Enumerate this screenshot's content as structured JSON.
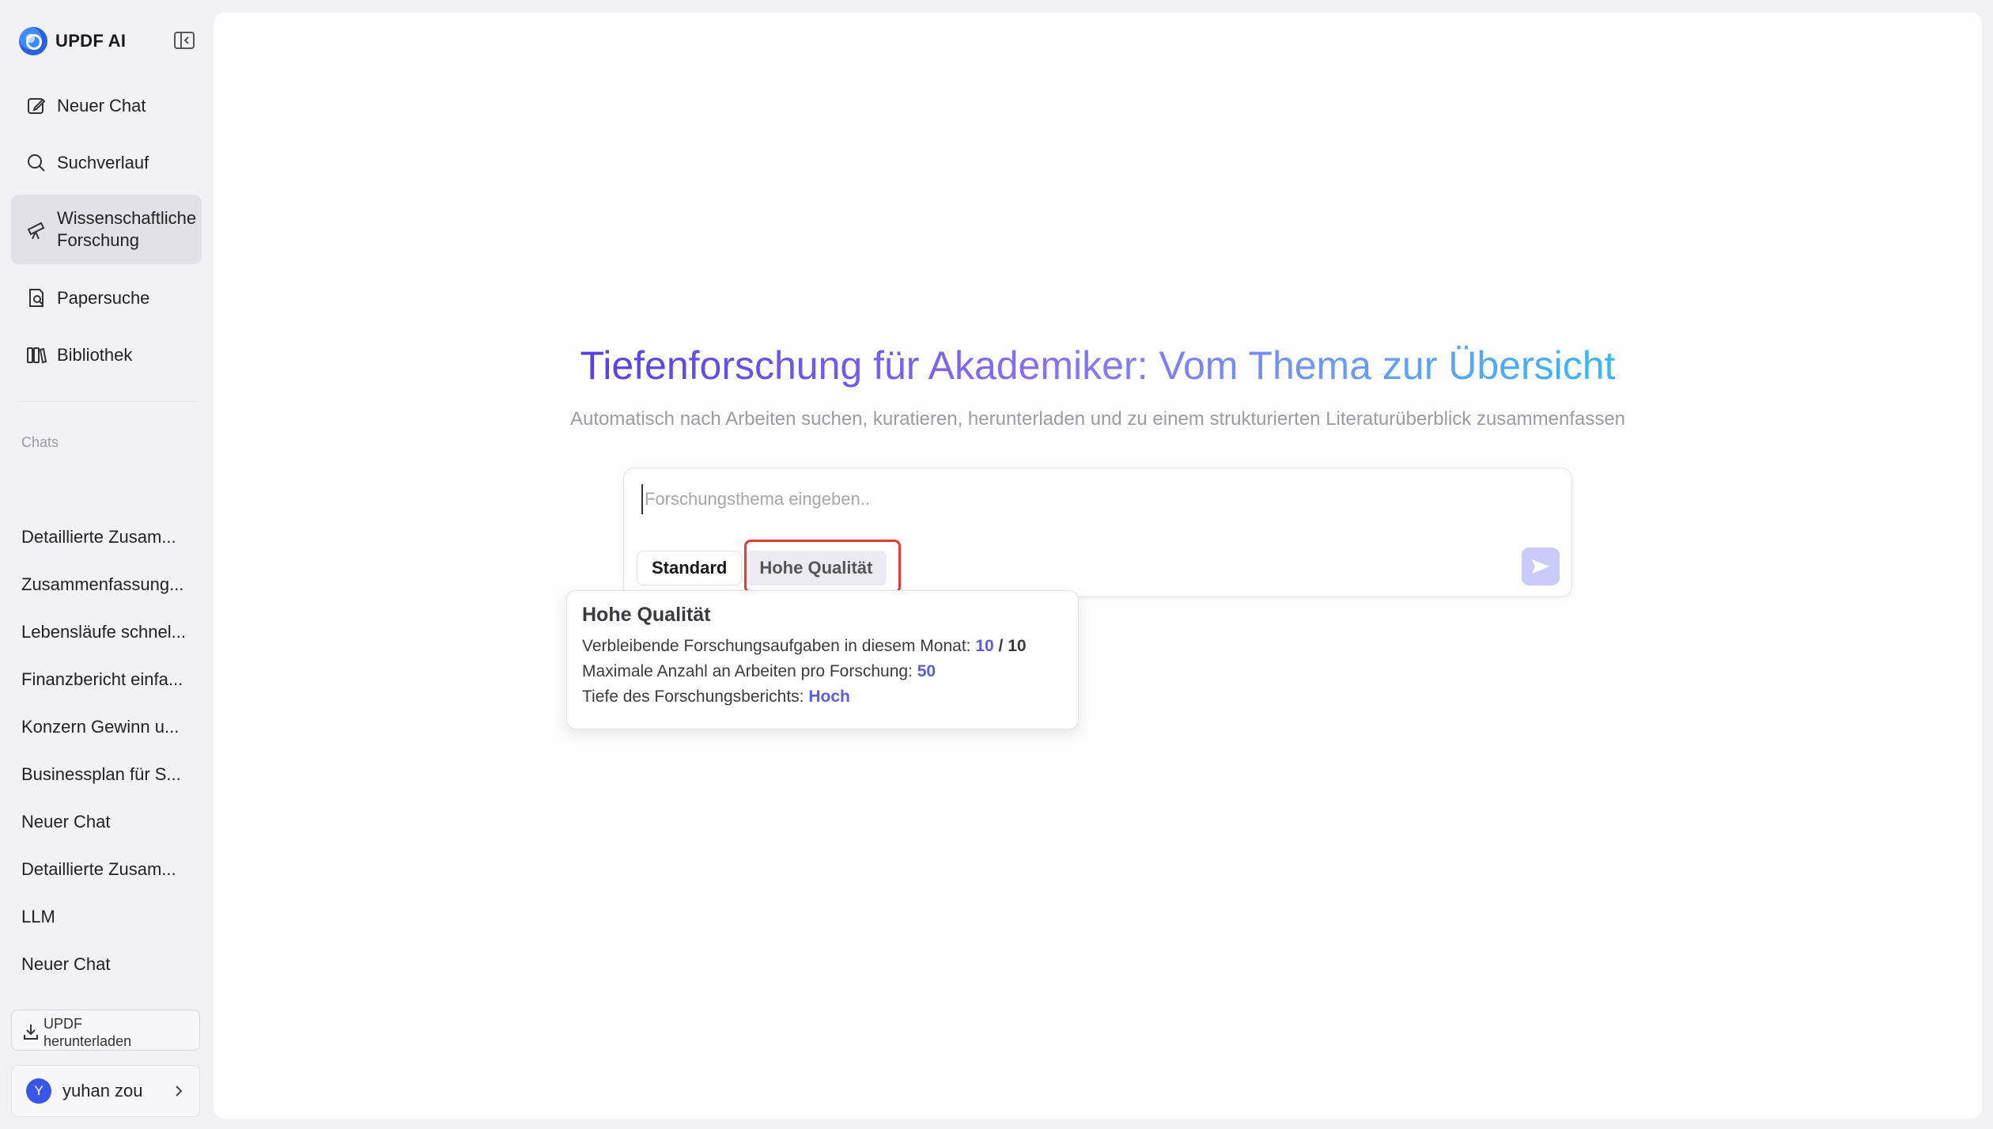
{
  "brand": {
    "name": "UPDF AI"
  },
  "nav": [
    {
      "label": "Neuer Chat",
      "icon": "edit-icon"
    },
    {
      "label": "Suchverlauf",
      "icon": "search-icon"
    },
    {
      "label": "Wissenschaftliche Forschung",
      "icon": "telescope-icon",
      "active": true
    },
    {
      "label": "Papersuche",
      "icon": "paper-search-icon"
    },
    {
      "label": "Bibliothek",
      "icon": "library-icon"
    }
  ],
  "chats_section": {
    "label": "Chats"
  },
  "chats": [
    "Detaillierte Zusam...",
    "Zusammenfassung...",
    "Lebensläufe schnel...",
    "Finanzbericht einfa...",
    "Konzern Gewinn u...",
    "Businessplan für S...",
    "Neuer Chat",
    "Detaillierte Zusam...",
    "LLM",
    "Neuer Chat"
  ],
  "download": {
    "label": "UPDF herunterladen"
  },
  "user": {
    "initial": "Y",
    "name": "yuhan zou"
  },
  "hero": {
    "title": "Tiefenforschung für Akademiker: Vom Thema zur Übersicht",
    "subtitle": "Automatisch nach Arbeiten suchen, kuratieren, herunterladen und zu einem strukturierten Literaturüberblick zusammenfassen"
  },
  "input": {
    "placeholder": "Forschungsthema eingeben..",
    "value": ""
  },
  "modes": {
    "standard": "Standard",
    "high_quality": "Hohe Qualität"
  },
  "tooltip": {
    "title": "Hohe Qualität",
    "rows": {
      "tasks_label": "Verbleibende Forschungsaufgaben in diesem Monat:",
      "tasks_remaining": "10",
      "tasks_sep": " / ",
      "tasks_total": "10",
      "max_label": "Maximale Anzahl an Arbeiten pro Forschung:",
      "max_value": "50",
      "depth_label": "Tiefe des Forschungsberichts:",
      "depth_value": "Hoch"
    }
  },
  "colors": {
    "accent": "#5a5fd9",
    "highlight": "#e23b3b",
    "send_button": "#c9ccfa",
    "sidebar_active": "#e2e2e6"
  }
}
